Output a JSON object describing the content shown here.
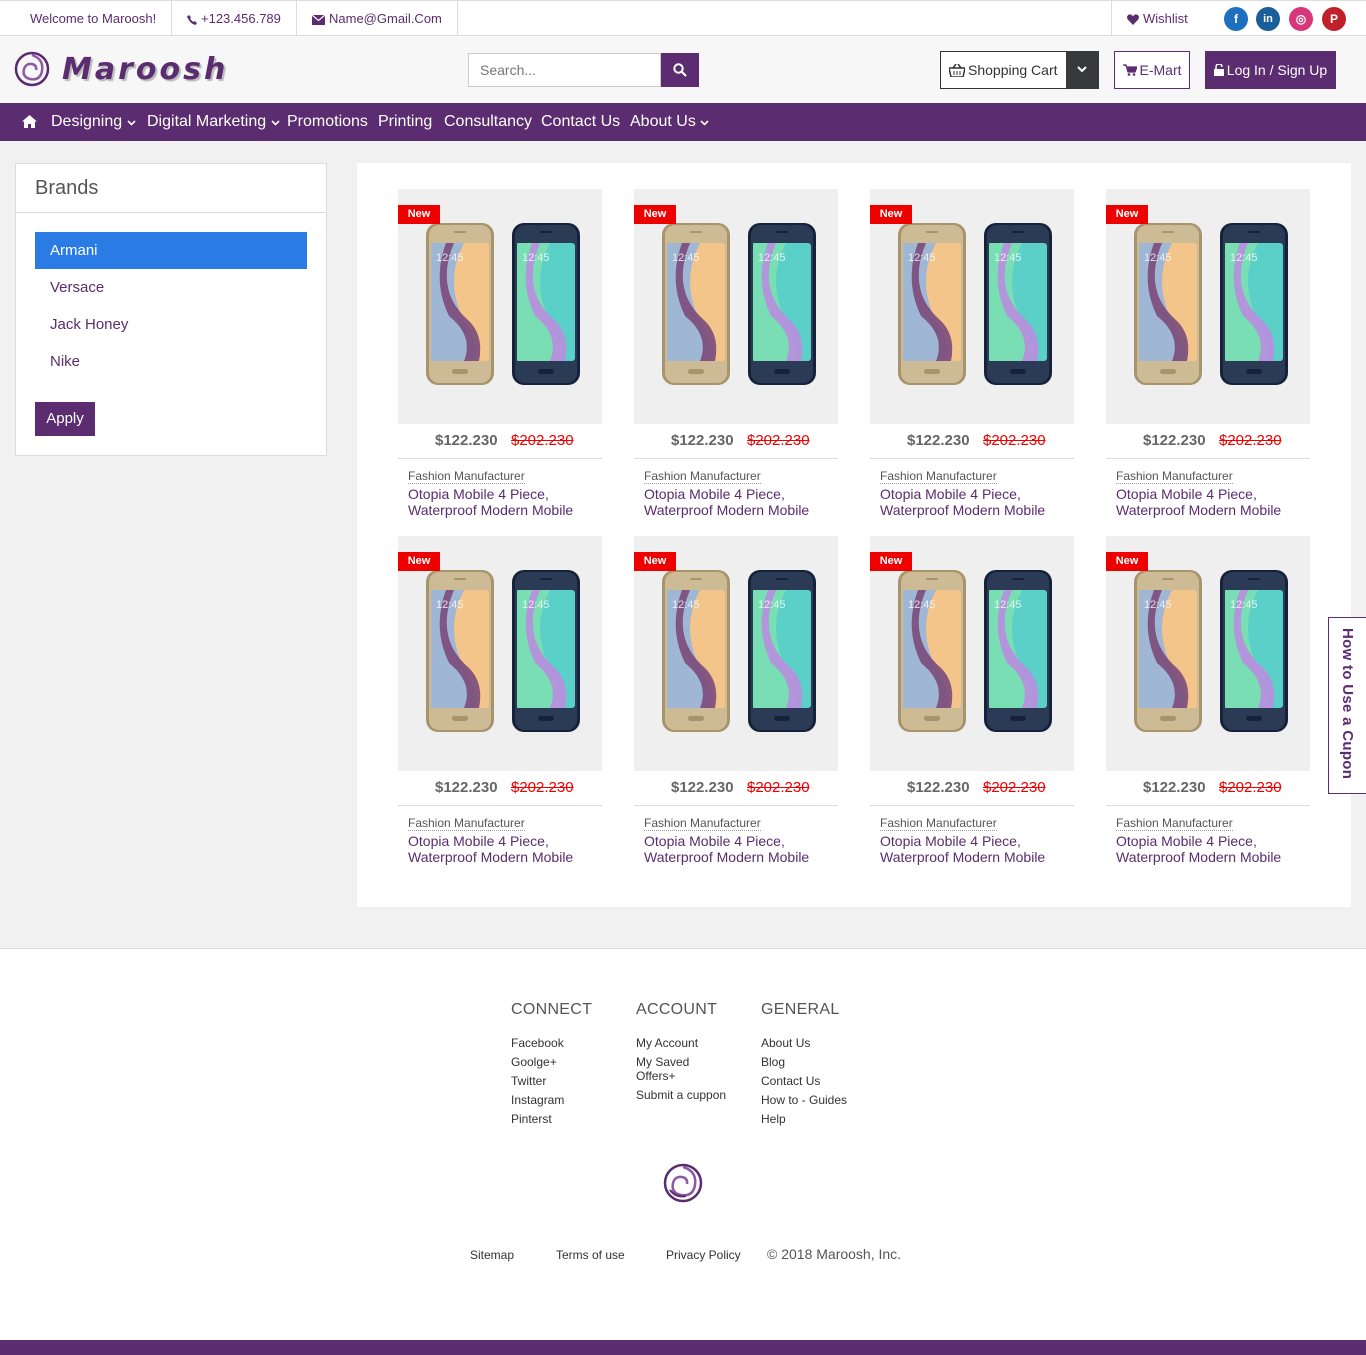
{
  "topbar": {
    "welcome": "Welcome to Maroosh!",
    "phone": "+123.456.789",
    "email": "Name@Gmail.Com",
    "wishlist": "Wishlist",
    "social": [
      {
        "name": "facebook",
        "glyph": "f",
        "color": "#1e6fc0"
      },
      {
        "name": "linkedin",
        "glyph": "in",
        "color": "#1a5f9a"
      },
      {
        "name": "instagram",
        "glyph": "◎",
        "color": "#d9357a"
      },
      {
        "name": "pinterest",
        "glyph": "P",
        "color": "#c0202a"
      }
    ]
  },
  "header": {
    "brand": "Maroosh",
    "search_placeholder": "Search...",
    "cart_label": "Shopping Cart",
    "emart_label": "E-Mart",
    "login_label": "Log In / Sign Up"
  },
  "nav": {
    "items": [
      {
        "label": "Designing"
      },
      {
        "label": "Digital Marketing"
      },
      {
        "label": "Promotions"
      },
      {
        "label": "Printing"
      },
      {
        "label": "Consultancy"
      },
      {
        "label": "Contact Us"
      },
      {
        "label": "About Us"
      }
    ]
  },
  "brands": {
    "title": "Brands",
    "items": [
      "Armani",
      "Versace",
      "Jack Honey",
      "Nike"
    ],
    "selected": "Armani",
    "apply_label": "Apply"
  },
  "product": {
    "badge": "New",
    "price": "$122.230",
    "old_price": "$202.230",
    "maker": "Fashion Manufacturer",
    "name_line1": "Otopia Mobile 4 Piece,",
    "name_line2": "Waterproof Modern Mobile",
    "count": 8
  },
  "coupon_tab": "How to Use a Cupon",
  "footer": {
    "connect": {
      "title": "CONNECT",
      "links": [
        "Facebook",
        "Goolge+",
        "Twitter",
        "Instagram",
        "Pinterst"
      ]
    },
    "account": {
      "title": "ACCOUNT",
      "links": [
        "My Account",
        "My Saved Offers+",
        "Submit a cuppon"
      ]
    },
    "general": {
      "title": "GENERAL",
      "links": [
        "About Us",
        "Blog",
        "Contact Us",
        "How to - Guides",
        "Help"
      ]
    },
    "bottom_links": [
      "Sitemap",
      "Terms of use",
      "Privacy Policy"
    ],
    "copyright": "© 2018 Maroosh, Inc."
  },
  "colors": {
    "brand_purple": "#5b2c6f",
    "active_blue": "#2a7be4",
    "badge_red": "#ee0000"
  }
}
